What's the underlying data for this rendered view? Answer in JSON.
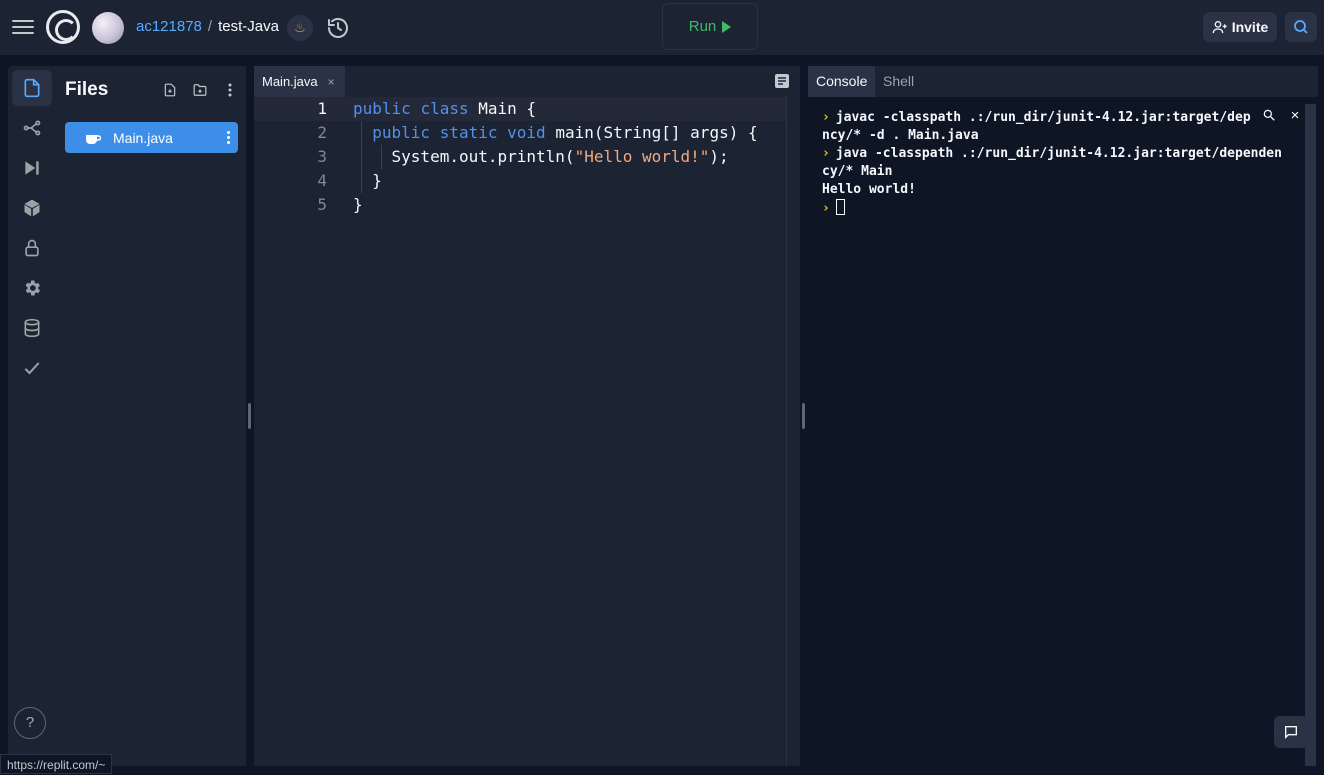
{
  "topbar": {
    "username": "ac121878",
    "separator": "/",
    "repl_name": "test-Java",
    "run_label": "Run",
    "invite_label": "Invite"
  },
  "sidebar": {
    "icons": [
      "files-icon",
      "git-icon",
      "debugger-icon",
      "packages-icon",
      "secrets-icon",
      "settings-icon",
      "database-icon",
      "unit-tests-icon"
    ],
    "help_label": "?"
  },
  "files": {
    "title": "Files",
    "items": [
      {
        "label": "Main.java",
        "icon": "java-cup-icon"
      }
    ]
  },
  "editor": {
    "tab_label": "Main.java",
    "tab_close": "×",
    "lines": [
      {
        "n": "1",
        "tokens": [
          [
            "kw",
            "public "
          ],
          [
            "kw",
            "class "
          ],
          [
            "",
            "Main {"
          ]
        ]
      },
      {
        "n": "2",
        "tokens": [
          [
            "",
            "  "
          ],
          [
            "kw",
            "public "
          ],
          [
            "kw",
            "static "
          ],
          [
            "kw",
            "void "
          ],
          [
            "",
            "main(String[] args) {"
          ]
        ]
      },
      {
        "n": "3",
        "tokens": [
          [
            "",
            "    System.out.println("
          ],
          [
            "str",
            "\"Hello world!\""
          ],
          [
            "",
            ");"
          ]
        ]
      },
      {
        "n": "4",
        "tokens": [
          [
            "",
            "  }"
          ]
        ]
      },
      {
        "n": "5",
        "tokens": [
          [
            "",
            "}"
          ]
        ]
      }
    ]
  },
  "console": {
    "tabs": [
      "Console",
      "Shell"
    ],
    "lines": [
      {
        "prompt": true,
        "text": "javac -classpath .:/run_dir/junit-4.12.jar:target/dep"
      },
      {
        "prompt": false,
        "text": "ncy/* -d . Main.java"
      },
      {
        "prompt": true,
        "text": "java -classpath .:/run_dir/junit-4.12.jar:target/dependen"
      },
      {
        "prompt": false,
        "text": "cy/* Main"
      },
      {
        "prompt": false,
        "text": "Hello world!"
      }
    ],
    "prompt_symbol": "›",
    "clear_label": "×"
  },
  "status_url": "https://replit.com/~",
  "colors": {
    "accent": "#3d8ee8",
    "run": "#3fba67",
    "link": "#57abff",
    "keyword": "#5291ec",
    "string": "#f1a97d"
  }
}
